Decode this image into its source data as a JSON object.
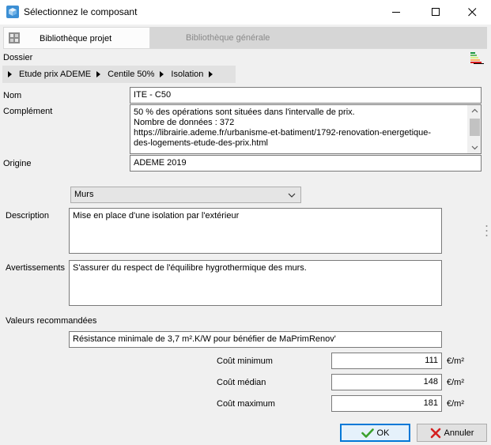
{
  "window": {
    "title": "Sélectionnez le composant"
  },
  "tabs": [
    {
      "label": "Bibliothèque projet",
      "active": true
    },
    {
      "label": "Bibliothèque générale",
      "active": false
    }
  ],
  "folder": {
    "label": "Dossier",
    "breadcrumb": [
      "Etude prix ADEME",
      "Centile 50%",
      "Isolation"
    ]
  },
  "form": {
    "nom_label": "Nom",
    "nom_value": "ITE - C50",
    "complement_label": "Complément",
    "complement_lines": [
      "50 % des opérations sont situées dans l'intervalle de prix.",
      "Nombre de données : 372",
      "https://librairie.ademe.fr/urbanisme-et-batiment/1792-renovation-energetique-",
      "des-logements-etude-des-prix.html"
    ],
    "origine_label": "Origine",
    "origine_value": "ADEME 2019",
    "category_selected": "Murs",
    "description_label": "Description",
    "description_value": "Mise en place d'une isolation par l'extérieur",
    "avertissements_label": "Avertissements",
    "avertissements_value": "S'assurer du respect de l'équilibre hygrothermique des murs.",
    "valeurs_label": "Valeurs recommandées",
    "valeurs_value": "Résistance minimale de 3,7 m².K/W pour bénéfier de MaPrimRenov'",
    "cout_min_label": "Coût minimum",
    "cout_min_value": "111",
    "cout_med_label": "Coût médian",
    "cout_med_value": "148",
    "cout_max_label": "Coût maximum",
    "cout_max_value": "181",
    "unit": "€/m²"
  },
  "buttons": {
    "ok": "OK",
    "cancel": "Annuler"
  },
  "colors": {
    "accent": "#0078d7",
    "ok_check": "#3aa02c",
    "cancel_x": "#d42020"
  }
}
